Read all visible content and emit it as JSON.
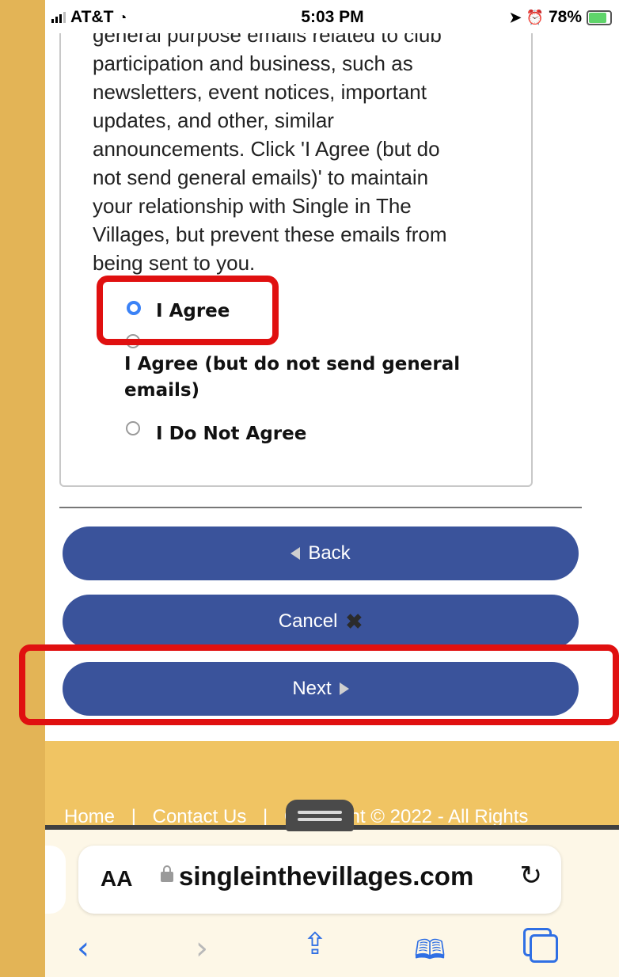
{
  "status_bar": {
    "carrier": "AT&T",
    "time": "5:03 PM",
    "battery": "78%"
  },
  "terms": {
    "text_lines": [
      "general purpose emails related to club",
      "participation and business, such as",
      "newsletters, event notices, important",
      "updates, and other, similar",
      "announcements. Click 'I Agree (but do",
      "not send general emails)' to maintain",
      "your relationship with Single in The",
      "Villages, but prevent these emails from",
      "being sent to you."
    ],
    "options": [
      {
        "label": "I Agree",
        "checked": true
      },
      {
        "label_line1": "I Agree (but do not send general",
        "label_line2": "emails)",
        "checked": false
      },
      {
        "label": "I Do Not Agree",
        "checked": false
      }
    ]
  },
  "buttons": {
    "back": "Back",
    "cancel": "Cancel",
    "next": "Next"
  },
  "footer": {
    "home": "Home",
    "sep1": "|",
    "contact": "Contact Us",
    "sep2": "|",
    "copyright": "Copyright © 2022 - All Rights"
  },
  "browser": {
    "aa": "AA",
    "domain": "singleinthevillages.com"
  },
  "colors": {
    "button": "#3a539b",
    "highlight": "#e01010",
    "background": "#e3b456",
    "footer": "#f0c463"
  },
  "icons": {
    "back": "triangle-left-icon",
    "cancel": "x-icon",
    "next": "triangle-right-icon",
    "reload": "reload-icon",
    "share": "share-icon",
    "bookmarks": "book-icon",
    "tabs": "tabs-icon"
  }
}
